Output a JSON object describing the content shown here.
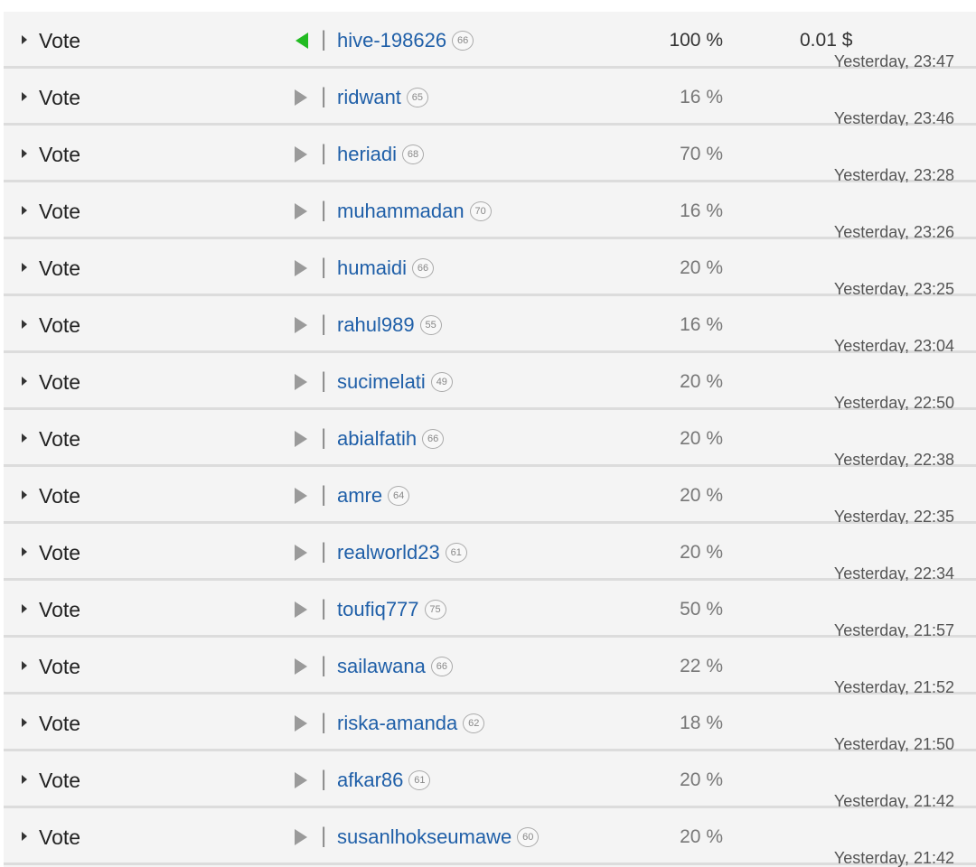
{
  "colors": {
    "upvote_active": "#22bb22",
    "upvote_inactive": "#9a9a9a",
    "link": "#1f5fa8",
    "row_bg": "#f4f4f4",
    "separator": "#dcdcdc"
  },
  "icons": {
    "expand": "caret-right-icon",
    "vote_active": "vote-arrow-left-icon",
    "vote_inactive": "vote-arrow-right-icon"
  },
  "votes": [
    {
      "label": "Vote",
      "voter": "hive-198626",
      "rep": "66",
      "percent": "100 %",
      "value": "0.01 $",
      "time": "Yesterday, 23:47",
      "active": true
    },
    {
      "label": "Vote",
      "voter": "ridwant",
      "rep": "65",
      "percent": "16 %",
      "value": "",
      "time": "Yesterday, 23:46",
      "active": false
    },
    {
      "label": "Vote",
      "voter": "heriadi",
      "rep": "68",
      "percent": "70 %",
      "value": "",
      "time": "Yesterday, 23:28",
      "active": false
    },
    {
      "label": "Vote",
      "voter": "muhammadan",
      "rep": "70",
      "percent": "16 %",
      "value": "",
      "time": "Yesterday, 23:26",
      "active": false
    },
    {
      "label": "Vote",
      "voter": "humaidi",
      "rep": "66",
      "percent": "20 %",
      "value": "",
      "time": "Yesterday, 23:25",
      "active": false
    },
    {
      "label": "Vote",
      "voter": "rahul989",
      "rep": "55",
      "percent": "16 %",
      "value": "",
      "time": "Yesterday, 23:04",
      "active": false
    },
    {
      "label": "Vote",
      "voter": "sucimelati",
      "rep": "49",
      "percent": "20 %",
      "value": "",
      "time": "Yesterday, 22:50",
      "active": false
    },
    {
      "label": "Vote",
      "voter": "abialfatih",
      "rep": "66",
      "percent": "20 %",
      "value": "",
      "time": "Yesterday, 22:38",
      "active": false
    },
    {
      "label": "Vote",
      "voter": "amre",
      "rep": "64",
      "percent": "20 %",
      "value": "",
      "time": "Yesterday, 22:35",
      "active": false
    },
    {
      "label": "Vote",
      "voter": "realworld23",
      "rep": "61",
      "percent": "20 %",
      "value": "",
      "time": "Yesterday, 22:34",
      "active": false
    },
    {
      "label": "Vote",
      "voter": "toufiq777",
      "rep": "75",
      "percent": "50 %",
      "value": "",
      "time": "Yesterday, 21:57",
      "active": false
    },
    {
      "label": "Vote",
      "voter": "sailawana",
      "rep": "66",
      "percent": "22 %",
      "value": "",
      "time": "Yesterday, 21:52",
      "active": false
    },
    {
      "label": "Vote",
      "voter": "riska-amanda",
      "rep": "62",
      "percent": "18 %",
      "value": "",
      "time": "Yesterday, 21:50",
      "active": false
    },
    {
      "label": "Vote",
      "voter": "afkar86",
      "rep": "61",
      "percent": "20 %",
      "value": "",
      "time": "Yesterday, 21:42",
      "active": false
    },
    {
      "label": "Vote",
      "voter": "susanlhokseumawe",
      "rep": "60",
      "percent": "20 %",
      "value": "",
      "time": "Yesterday, 21:42",
      "active": false
    }
  ]
}
